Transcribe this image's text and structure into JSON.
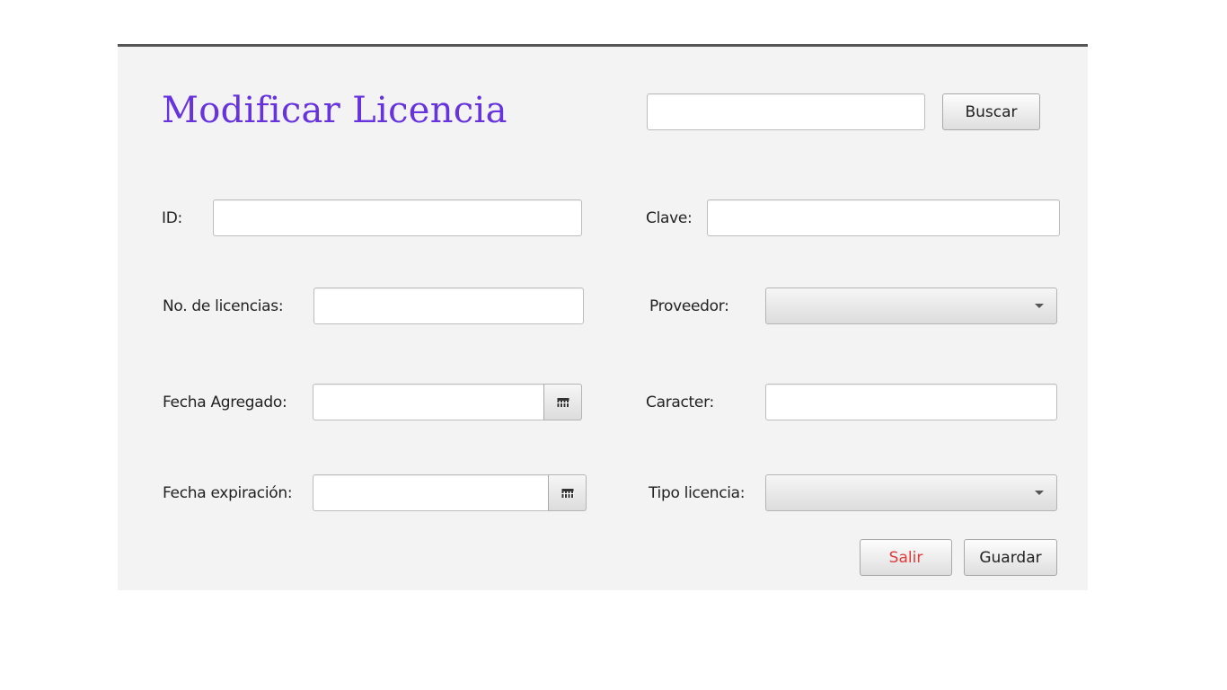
{
  "form": {
    "title": "Modificar Licencia",
    "search": {
      "value": "",
      "button_label": "Buscar"
    },
    "fields": {
      "id": {
        "label": "ID:",
        "value": ""
      },
      "clave": {
        "label": "Clave:",
        "value": ""
      },
      "num_licencias": {
        "label": "No. de licencias:",
        "value": ""
      },
      "proveedor": {
        "label": "Proveedor:",
        "selected": ""
      },
      "fecha_agregado": {
        "label": "Fecha Agregado:",
        "value": ""
      },
      "caracter": {
        "label": "Caracter:",
        "value": ""
      },
      "fecha_expiracion": {
        "label": "Fecha expiración:",
        "value": ""
      },
      "tipo_licencia": {
        "label": "Tipo licencia:",
        "selected": ""
      }
    },
    "buttons": {
      "exit_label": "Salir",
      "save_label": "Guardar"
    },
    "colors": {
      "title": "#6633dd",
      "exit_text": "#e03a3a",
      "panel_bg": "#f3f3f3"
    }
  }
}
